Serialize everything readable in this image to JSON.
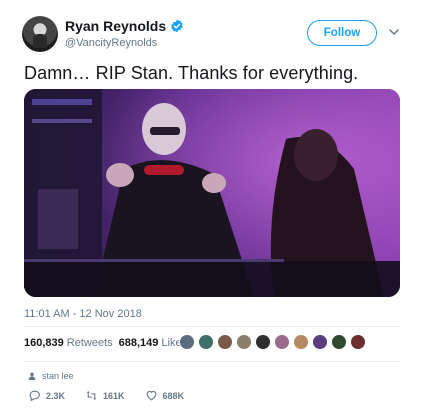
{
  "tweet": {
    "display_name": "Ryan Reynolds",
    "handle": "@VancityReynolds",
    "follow_label": "Follow",
    "text": "Damn… RIP Stan. Thanks for everything.",
    "timestamp": "11:01 AM - 12 Nov 2018",
    "retweets_count": "160,839",
    "retweets_label": "Retweets",
    "likes_count": "688,149",
    "likes_label": "Likes",
    "topic": "stan lee",
    "reply_count": "2.3K",
    "retweet_count_short": "161K",
    "like_count_short": "688K"
  },
  "icons": {
    "verified": "verified-badge-icon",
    "more": "chevron-down-icon",
    "topic": "person-icon",
    "reply": "reply-icon",
    "retweet": "retweet-icon",
    "like": "heart-icon"
  },
  "colors": {
    "accent": "#1da1f2",
    "text_primary": "#14171a",
    "text_secondary": "#657786",
    "divider": "#e6ecf0"
  },
  "liker_avatars": [
    "#5b6c80",
    "#3f6f6a",
    "#7a5a48",
    "#8a7d6a",
    "#2e2e2e",
    "#9a6b8a",
    "#b58a62",
    "#5a3d7a",
    "#2f4a2f",
    "#6b2f2f"
  ]
}
